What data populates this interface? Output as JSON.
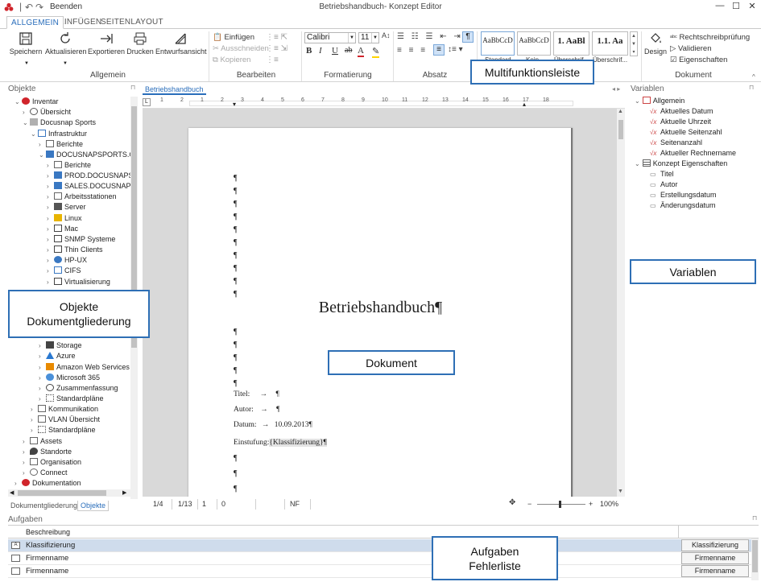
{
  "window": {
    "quit_label": "Beenden",
    "title": "Betriebshandbuch- Konzept Editor"
  },
  "ribbon_tabs": [
    "ALLGEMEIN",
    "EINFÜGEN",
    "SEITENLAYOUT"
  ],
  "ribbon": {
    "allgemein": {
      "buttons": [
        "Speichern",
        "Aktualisieren",
        "Exportieren",
        "Drucken",
        "Entwurfsansicht"
      ],
      "group_label": "Allgemein"
    },
    "bearbeiten": {
      "paste": "Einfügen",
      "cut": "Ausschneiden",
      "copy": "Kopieren",
      "group_label": "Bearbeiten"
    },
    "formatierung": {
      "font": "Calibri",
      "size": "11",
      "group_label": "Formatierung"
    },
    "absatz": {
      "group_label": "Absatz"
    },
    "styles": [
      {
        "preview": "AaBbCcD",
        "caption": "Standard"
      },
      {
        "preview": "AaBbCcD",
        "caption": "Kein ..."
      },
      {
        "preview": "1. AaBl",
        "caption": "Überschrif..."
      },
      {
        "preview": "1.1. Aa",
        "caption": "Überschrif..."
      }
    ],
    "dokument": {
      "design": "Design",
      "spellcheck": "Rechtschreibprüfung",
      "validate": "Validieren",
      "properties": "Eigenschaften",
      "group_label": "Dokument"
    }
  },
  "left_panel": {
    "title": "Objekte",
    "tree": [
      {
        "label": "Inventar",
        "level": 0,
        "icon": "inventory-icon"
      },
      {
        "label": "Übersicht",
        "level": 1,
        "icon": "globe-icon"
      },
      {
        "label": "Docusnap Sports",
        "level": 1,
        "icon": "building-icon"
      },
      {
        "label": "Infrastruktur",
        "level": 2,
        "icon": "network-icon"
      },
      {
        "label": "Berichte",
        "level": 3,
        "icon": "report-icon"
      },
      {
        "label": "DOCUSNAPSPORTS.COM",
        "level": 3,
        "icon": "domain-icon"
      },
      {
        "label": "Berichte",
        "level": 4,
        "icon": "report-icon"
      },
      {
        "label": "PROD.DOCUSNAPSPORTS",
        "level": 4,
        "icon": "domain-icon"
      },
      {
        "label": "SALES.DOCUSNAPSPORTS",
        "level": 4,
        "icon": "domain-icon"
      },
      {
        "label": "Arbeitsstationen",
        "level": 4,
        "icon": "workstation-icon"
      },
      {
        "label": "Server",
        "level": 4,
        "icon": "server-icon"
      },
      {
        "label": "Linux",
        "level": 4,
        "icon": "linux-icon"
      },
      {
        "label": "Mac",
        "level": 4,
        "icon": "mac-icon"
      },
      {
        "label": "SNMP Systeme",
        "level": 4,
        "icon": "snmp-icon"
      },
      {
        "label": "Thin Clients",
        "level": 4,
        "icon": "thin-client-icon"
      },
      {
        "label": "HP-UX",
        "level": 4,
        "icon": "hpux-icon"
      },
      {
        "label": "CIFS",
        "level": 4,
        "icon": "cifs-icon"
      },
      {
        "label": "Virtualisierung",
        "level": 4,
        "icon": "virtualization-icon"
      },
      {
        "label": "Storage",
        "level": 3,
        "icon": "storage-icon"
      },
      {
        "label": "Azure",
        "level": 3,
        "icon": "azure-icon"
      },
      {
        "label": "Amazon Web Services",
        "level": 3,
        "icon": "aws-icon"
      },
      {
        "label": "Microsoft 365",
        "level": 3,
        "icon": "cloud-icon"
      },
      {
        "label": "Zusammenfassung",
        "level": 3,
        "icon": "search-icon"
      },
      {
        "label": "Standardpläne",
        "level": 3,
        "icon": "plan-icon"
      },
      {
        "label": "Kommunikation",
        "level": 2,
        "icon": "communication-icon"
      },
      {
        "label": "VLAN Übersicht",
        "level": 2,
        "icon": "vlan-icon"
      },
      {
        "label": "Standardpläne",
        "level": 2,
        "icon": "plan-icon"
      },
      {
        "label": "Assets",
        "level": 1,
        "icon": "assets-icon"
      },
      {
        "label": "Standorte",
        "level": 1,
        "icon": "location-icon"
      },
      {
        "label": "Organisation",
        "level": 1,
        "icon": "organization-icon"
      },
      {
        "label": "Connect",
        "level": 1,
        "icon": "connect-icon"
      },
      {
        "label": "Dokumentation",
        "level": 0,
        "icon": "documentation-icon"
      }
    ],
    "tabs": [
      "Dokumentgliederung",
      "Objekte"
    ]
  },
  "document": {
    "tab": "Betriebshandbuch",
    "ruler_numbers": [
      "1",
      "2",
      "1",
      "2",
      "3",
      "4",
      "5",
      "6",
      "7",
      "8",
      "9",
      "10",
      "11",
      "12",
      "13",
      "14",
      "15",
      "16",
      "17",
      "18"
    ],
    "title": "Betriebshandbuch¶",
    "pilcrow": "¶",
    "lines": {
      "titel_label": "Titel:",
      "autor_label": "Autor:",
      "datum_label": "Datum:",
      "datum_value": "10.09.2013¶",
      "einstufung_label": "Einstufung:",
      "einstufung_value": "{Klassifizierung}¶",
      "arrow": "→"
    }
  },
  "statusbar": {
    "page": "1/4",
    "section": "1/13",
    "line": "1",
    "column": "0",
    "mode": "NF",
    "zoom": "100%"
  },
  "right_panel": {
    "title": "Variablen",
    "groups": [
      {
        "label": "Allgemein",
        "items": [
          "Aktuelles Datum",
          "Aktuelle Uhrzeit",
          "Aktuelle Seitenzahl",
          "Seitenanzahl",
          "Aktueller Rechnername"
        ]
      },
      {
        "label": "Konzept Eigenschaften",
        "items": [
          "Titel",
          "Autor",
          "Erstellungsdatum",
          "Änderungsdatum"
        ]
      }
    ]
  },
  "tasks": {
    "title": "Aufgaben",
    "header": "Beschreibung",
    "rows": [
      {
        "label": "Klassifizierung",
        "button": "Klassifizierung"
      },
      {
        "label": "Firmenname",
        "button": "Firmenname"
      },
      {
        "label": "Firmenname",
        "button": "Firmenname"
      }
    ]
  },
  "callouts": {
    "ribbon": "Multifunktionsleiste",
    "left": [
      "Objekte",
      "Dokumentgliederung"
    ],
    "document": "Dokument",
    "variables": "Variablen",
    "tasks": [
      "Aufgaben",
      "Fehlerliste"
    ]
  },
  "colors": {
    "accent": "#2a6ebb",
    "callout_border": "#2e6fb5",
    "logo_red": "#d0242b"
  }
}
